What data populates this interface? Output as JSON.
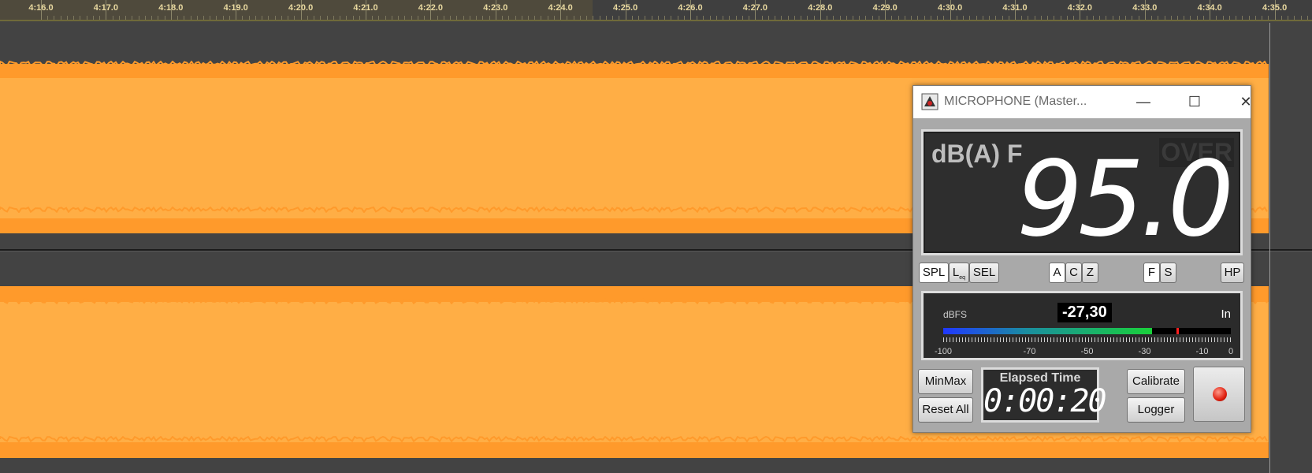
{
  "timeline": {
    "labels": [
      "4:16.0",
      "4:17.0",
      "4:18.0",
      "4:19.0",
      "4:20.0",
      "4:21.0",
      "4:22.0",
      "4:23.0",
      "4:24.0",
      "4:25.0",
      "4:26.0",
      "4:27.0",
      "4:28.0",
      "4:29.0",
      "4:30.0",
      "4:31.0",
      "4:32.0",
      "4:33.0",
      "4:34.0",
      "4:35.0"
    ]
  },
  "colors": {
    "background": "#434343",
    "waveform": "#ff9a2b",
    "waveform_inner": "#ffae45",
    "ruler_text": "#e9d9a0"
  },
  "window": {
    "title": "MICROPHONE (Master...",
    "minimize_icon": "minimize-icon",
    "maximize_icon": "maximize-icon",
    "close_icon": "close-icon"
  },
  "display": {
    "unit": "dB(A) F",
    "over": "OVER",
    "reading": "95.0"
  },
  "modes": {
    "spl": "SPL",
    "leq_main": "L",
    "leq_sub": "eq",
    "sel": "SEL",
    "a": "A",
    "c": "C",
    "z": "Z",
    "f": "F",
    "s": "S",
    "hp": "HP"
  },
  "meter": {
    "label": "dBFS",
    "value": "-27,30",
    "channel": "In",
    "level_fraction": 0.725,
    "peak_fraction": 0.81,
    "ticks": [
      "-100",
      "-70",
      "-50",
      "-30",
      "-10",
      "0"
    ]
  },
  "controls": {
    "minmax": "MinMax",
    "reset_all": "Reset All",
    "calibrate": "Calibrate",
    "logger": "Logger"
  },
  "elapsed": {
    "title": "Elapsed Time",
    "time": "0:00:20"
  }
}
